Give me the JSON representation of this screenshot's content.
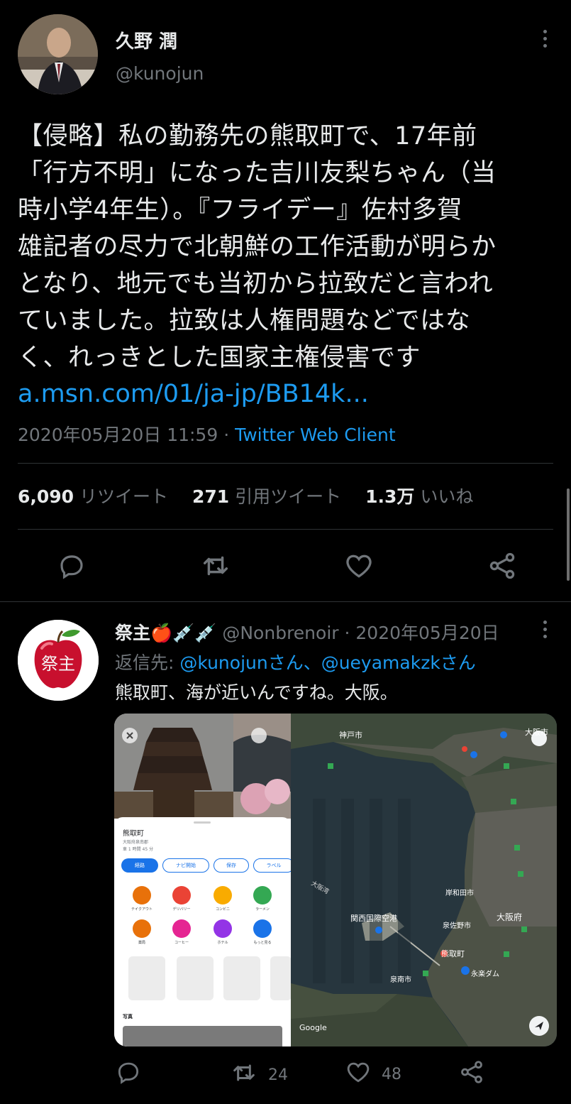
{
  "main_tweet": {
    "display_name": "久野 潤",
    "handle": "@kunojun",
    "text_lines": [
      "【侵略】私の勤務先の熊取町で、17年前",
      "「行方不明」になった吉川友梨ちゃん（当",
      "時小学4年生）。『フライデー』佐村多賀",
      "雄記者の尽力で北朝鮮の工作活動が明らか",
      "となり、地元でも当初から拉致だと言われ",
      "ていました。拉致は人権問題などではな",
      "く、れっきとした国家主権侵害です"
    ],
    "link": "a.msn.com/01/ja-jp/BB14k...",
    "timestamp": "2020年05月20日 11:59",
    "separator": " · ",
    "client": "Twitter Web Client",
    "stats": {
      "retweets_count": "6,090",
      "retweets_label": "リツイート",
      "quotes_count": "271",
      "quotes_label": "引用ツイート",
      "likes_count": "1.3万",
      "likes_label": "いいね"
    }
  },
  "reply_tweet": {
    "display_name": "祭主",
    "name_emojis": "🍎💉💉",
    "handle": "@Nonbrenoir",
    "separator": " · ",
    "date": "2020年05月20日",
    "replying_label": "返信先: ",
    "replying_mentions": "@kunojunさん、@ueyamakzkさん",
    "text": "熊取町、海が近いんですね。大阪。",
    "avatar_text": "祭主",
    "media": {
      "place_name": "熊取町",
      "place_sub": "大阪府泉南郡",
      "place_time": "車 1 時間 45 分",
      "chips": [
        "経路",
        "ナビ開始",
        "保存",
        "ラベル"
      ],
      "categories": [
        "テイクアウト",
        "デリバリー",
        "コンビニ",
        "ラーメン",
        "薬局",
        "コーヒー",
        "ホテル",
        "もっと見る"
      ],
      "photos_label": "写真",
      "map_labels": {
        "kobe": "神戸市",
        "osaka_city": "大阪市",
        "osaka_bay": "大阪湾",
        "kix": "関西国際空港",
        "osaka_pref": "大阪府",
        "kumatori": "熊取町",
        "sennan": "泉南市",
        "kishiwada": "岸和田市",
        "izumisano": "泉佐野市",
        "dam": "永楽ダム",
        "google": "Google"
      }
    },
    "actions": {
      "retweets": "24",
      "likes": "48"
    }
  },
  "colors": {
    "background": "#000000",
    "text": "#e7e9ea",
    "muted": "#71767b",
    "accent": "#1d9bf0",
    "divider": "#2f3336"
  }
}
